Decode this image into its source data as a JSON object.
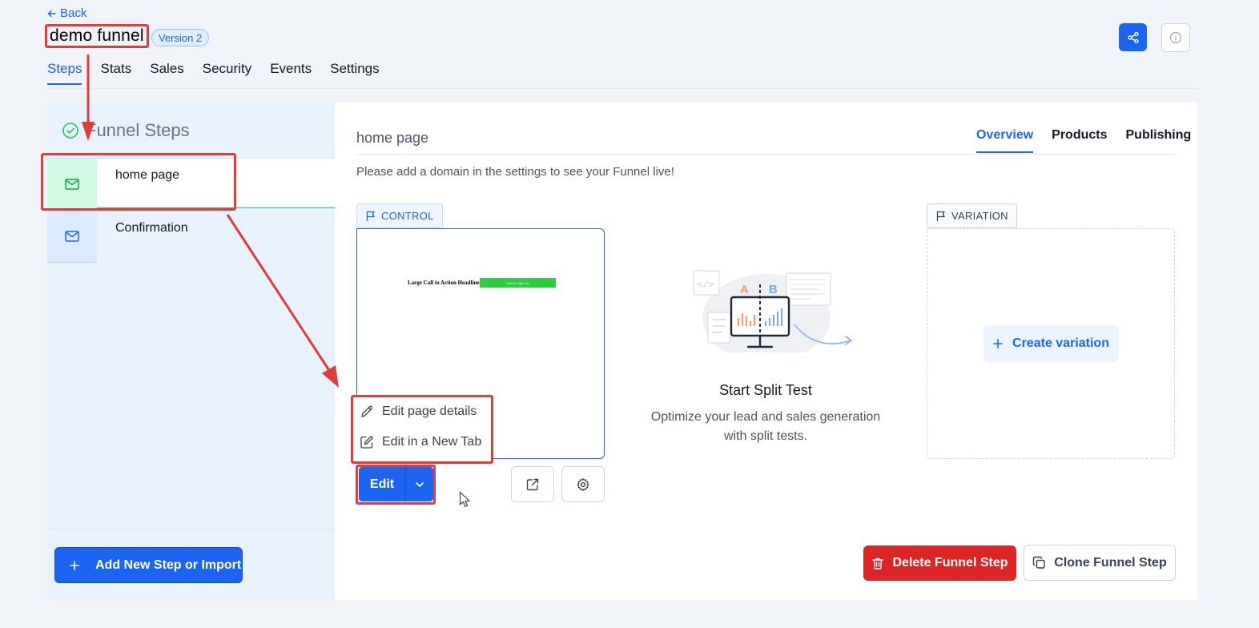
{
  "header": {
    "back_label": "Back",
    "title": "demo funnel",
    "version_badge": "Version 2"
  },
  "main_tabs": [
    {
      "label": "Steps",
      "active": true
    },
    {
      "label": "Stats"
    },
    {
      "label": "Sales"
    },
    {
      "label": "Security"
    },
    {
      "label": "Events"
    },
    {
      "label": "Settings"
    }
  ],
  "sidebar": {
    "title": "Funnel Steps",
    "steps": [
      {
        "label": "home page",
        "icon": "mail-icon",
        "active": true
      },
      {
        "label": "Confirmation",
        "icon": "mail-icon"
      }
    ],
    "add_button_label": "Add New Step or Import"
  },
  "step": {
    "name": "home page",
    "sub_tabs": [
      {
        "label": "Overview",
        "active": true
      },
      {
        "label": "Products"
      },
      {
        "label": "Publishing"
      }
    ],
    "notice": "Please add a domain in the settings to see your Funnel live!",
    "control": {
      "badge": "CONTROL",
      "preview_headline": "Large Call to Action Headline",
      "preview_cta": "Click to Sign Up"
    },
    "menu": {
      "edit_details": "Edit page details",
      "edit_new_tab": "Edit in a New Tab"
    },
    "edit_label": "Edit",
    "split_test": {
      "title": "Start Split Test",
      "description": "Optimize your lead and sales generation with split tests."
    },
    "variation": {
      "badge": "VARIATION",
      "create_label": "Create variation"
    },
    "delete_label": "Delete Funnel Step",
    "clone_label": "Clone Funnel Step"
  },
  "colors": {
    "primary": "#1c64f2",
    "danger": "#dc2626",
    "success": "#22c55e",
    "annotation": "#e03c3c"
  }
}
